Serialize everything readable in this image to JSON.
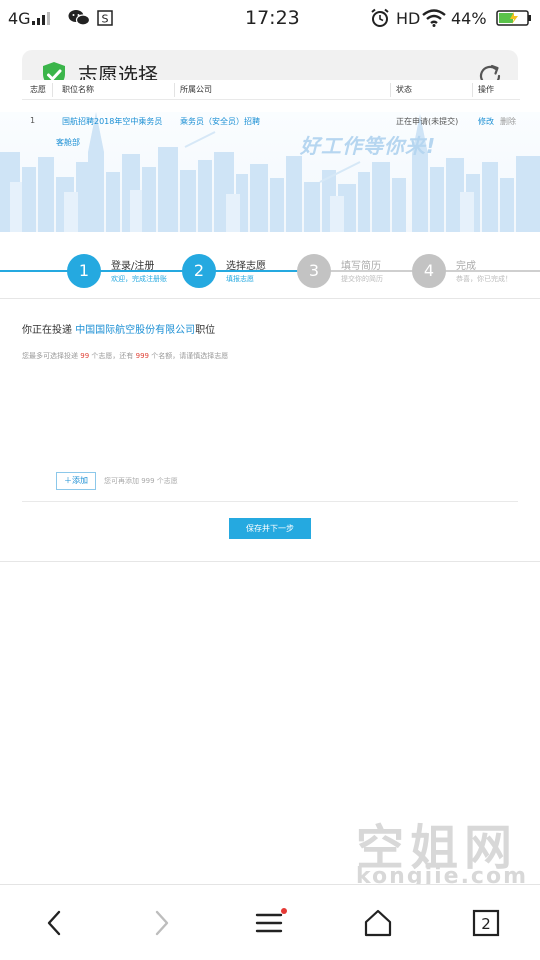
{
  "status_bar": {
    "network": "4G",
    "time": "17:23",
    "hd": "HD",
    "battery": "44%",
    "icons": [
      "signal-icon",
      "wechat-icon",
      "notification-s-icon",
      "alarm-icon",
      "wifi-icon",
      "battery-icon"
    ]
  },
  "url_bar": {
    "title": "志愿选择",
    "icons": [
      "shield-check-icon",
      "refresh-icon"
    ]
  },
  "banner": {
    "slogan": "好工作等你来!"
  },
  "steps": [
    {
      "number": "1",
      "title": "登录/注册",
      "sub": "欢迎，完成注册账",
      "state": "active"
    },
    {
      "number": "2",
      "title": "选择志愿",
      "sub": "填报志愿",
      "state": "active"
    },
    {
      "number": "3",
      "title": "填写简历",
      "sub": "提交你的简历",
      "state": "inactive"
    },
    {
      "number": "4",
      "title": "完成",
      "sub": "恭喜，你已完成！",
      "state": "inactive"
    }
  ],
  "apply": {
    "prefix": "你正在投递",
    "company": "中国国际航空股份有限公司",
    "suffix": "职位",
    "hint_a": "您最多可选择投递",
    "hint_n1": "99",
    "hint_b": "个志愿，还有",
    "hint_n2": "999",
    "hint_c": "个名额，请谨慎选择志愿"
  },
  "table": {
    "headers": [
      "志愿",
      "职位名称",
      "所属公司",
      "状态",
      "操作"
    ],
    "rows": [
      {
        "order": "1",
        "position_line1": "国航招聘2018年空中乘务员",
        "position_line2": "客舱部",
        "company": "乘务员（安全员）招聘",
        "status": "正在申请(未提交)",
        "action_edit": "修改",
        "action_delete": "删除"
      }
    ]
  },
  "add": {
    "label": "＋添加",
    "hint": "您可再添加 999 个志愿"
  },
  "save_label": "保存并下一步",
  "watermark": {
    "cn": "空姐网",
    "en": "kongjie.com"
  },
  "bottom_nav": {
    "tabs_count": "2",
    "icons": [
      "back-arrow-icon",
      "forward-arrow-icon",
      "menu-icon",
      "home-icon",
      "tabs-icon"
    ],
    "menu_badge_color": "#e53935"
  },
  "colors": {
    "accent": "#25a9e0",
    "link": "#1b8fd4",
    "inactive_step": "#c3c3c3",
    "shield": "#3bb54a"
  }
}
